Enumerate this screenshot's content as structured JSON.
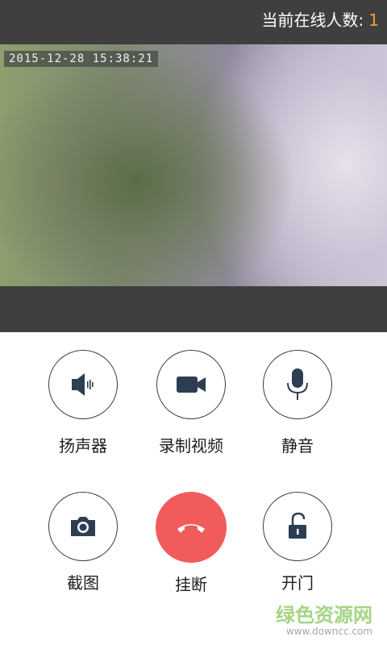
{
  "header": {
    "online_label": "当前在线人数:",
    "online_count": "1"
  },
  "video": {
    "timestamp": "2015-12-28  15:38:21"
  },
  "controls": {
    "speaker": {
      "label": "扬声器",
      "icon": "speaker-icon"
    },
    "record": {
      "label": "录制视频",
      "icon": "video-camera-icon"
    },
    "mute": {
      "label": "静音",
      "icon": "microphone-icon"
    },
    "screenshot": {
      "label": "截图",
      "icon": "camera-icon"
    },
    "hangup": {
      "label": "挂断",
      "icon": "phone-hangup-icon"
    },
    "unlock": {
      "label": "开门",
      "icon": "unlock-icon"
    }
  },
  "watermark": {
    "main": "绿色资源网",
    "sub": "www.downcc.com"
  },
  "colors": {
    "top_bg": "#3f3f3f",
    "count_accent": "#f5a023",
    "icon_dark": "#2e3e52",
    "hangup_red": "#f25b5b"
  }
}
